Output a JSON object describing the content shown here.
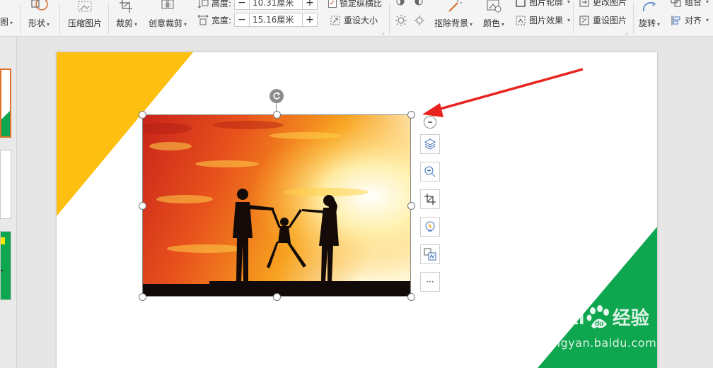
{
  "ribbon": {
    "left_partial_label": "图",
    "shape_label": "形状",
    "compress_label": "压缩图片",
    "crop_label": "裁剪",
    "creative_crop_label": "创意裁剪",
    "height_label": "高度:",
    "height_value": "10.31厘米",
    "width_label": "宽度:",
    "width_value": "15.16厘米",
    "lock_ratio_label": "锁定纵横比",
    "reset_size_label": "重设大小",
    "remove_bg_label": "抠除背景",
    "color_label": "颜色",
    "picture_outline_label": "图片轮廓",
    "picture_effect_label": "图片效果",
    "change_picture_label": "更改图片",
    "reset_picture_label": "重设图片",
    "rotate_label": "旋转",
    "group_label": "组合",
    "align_label": "对齐",
    "minus": "−",
    "plus": "+"
  },
  "side_tools": {
    "more_label": "···"
  },
  "watermark": {
    "brand": "Bai",
    "brand_cn": "经验",
    "url": "jingyan.baidu.com"
  },
  "colors": {
    "accent_yellow": "#FDC010",
    "accent_green": "#0EA64F",
    "arrow_red": "#E8231E",
    "ribbon_bg": "#F4F4F4"
  }
}
